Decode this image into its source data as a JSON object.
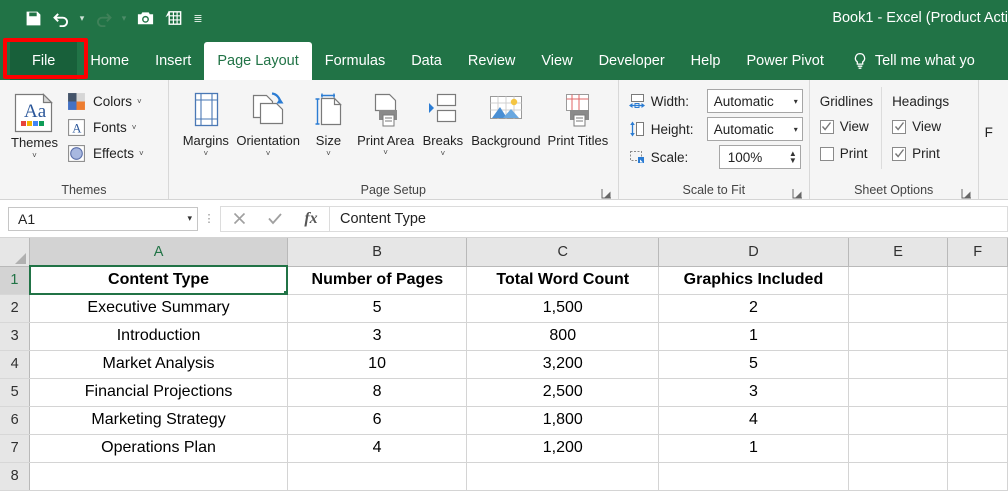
{
  "titlebar": {
    "app_title": "Book1  -  Excel (Product Acti",
    "quick_access": [
      {
        "name": "save-icon",
        "label": "Save"
      },
      {
        "name": "undo-icon",
        "label": "Undo"
      },
      {
        "name": "redo-icon",
        "label": "Redo"
      },
      {
        "name": "camera-icon",
        "label": "Camera"
      },
      {
        "name": "quick-table-icon",
        "label": "Quick Table"
      },
      {
        "name": "customize-quick-access-toolbar-icon",
        "label": "Customize Quick Access Toolbar"
      }
    ]
  },
  "tabs": {
    "file": "File",
    "items": [
      {
        "label": "Home",
        "active": false
      },
      {
        "label": "Insert",
        "active": false
      },
      {
        "label": "Page Layout",
        "active": true
      },
      {
        "label": "Formulas",
        "active": false
      },
      {
        "label": "Data",
        "active": false
      },
      {
        "label": "Review",
        "active": false
      },
      {
        "label": "View",
        "active": false
      },
      {
        "label": "Developer",
        "active": false
      },
      {
        "label": "Help",
        "active": false
      },
      {
        "label": "Power Pivot",
        "active": false
      }
    ],
    "tell_me": "Tell me what yo",
    "highlight_color": "#ff0000"
  },
  "ribbon": {
    "accent_color": "#217346",
    "themes": {
      "group_label": "Themes",
      "big_button": {
        "label": "Themes",
        "arrow": "˅"
      },
      "small_buttons": [
        {
          "label": "Colors",
          "arrow": "˅"
        },
        {
          "label": "Fonts",
          "arrow": "˅"
        },
        {
          "label": "Effects",
          "arrow": "˅"
        }
      ]
    },
    "page_setup": {
      "group_label": "Page Setup",
      "buttons": [
        {
          "label": "Margins",
          "arrow": "˅"
        },
        {
          "label": "Orientation",
          "arrow": "˅"
        },
        {
          "label": "Size",
          "arrow": "˅"
        },
        {
          "label": "Print Area",
          "arrow": "˅"
        },
        {
          "label": "Breaks",
          "arrow": "˅"
        },
        {
          "label": "Background",
          "arrow": ""
        },
        {
          "label": "Print Titles",
          "arrow": ""
        }
      ]
    },
    "scale_to_fit": {
      "group_label": "Scale to Fit",
      "width_label": "Width:",
      "width_value": "Automatic",
      "height_label": "Height:",
      "height_value": "Automatic",
      "scale_label": "Scale:",
      "scale_value": "100%"
    },
    "sheet_options": {
      "group_label": "Sheet Options",
      "gridlines_head": "Gridlines",
      "gridlines_view": "View",
      "gridlines_view_checked": true,
      "gridlines_print": "Print",
      "gridlines_print_checked": false,
      "headings_head": "Headings",
      "headings_view": "View",
      "headings_view_checked": true,
      "headings_print": "Print",
      "headings_print_checked": true
    },
    "arrange": {
      "group_label_partial": "F"
    }
  },
  "formula_bar": {
    "name_box_value": "A1",
    "cancel_icon": "✕",
    "enter_icon": "✓",
    "function_icon": "fx",
    "formula_value": "Content Type"
  },
  "grid": {
    "columns": [
      "A",
      "B",
      "C",
      "D",
      "E",
      "F"
    ],
    "selected_cell": "A1",
    "rows": [
      {
        "num": "1",
        "cells": [
          "Content Type",
          "Number of Pages",
          "Total Word Count",
          "Graphics Included",
          "",
          ""
        ],
        "header": true
      },
      {
        "num": "2",
        "cells": [
          "Executive Summary",
          "5",
          "1,500",
          "2",
          "",
          ""
        ],
        "header": false
      },
      {
        "num": "3",
        "cells": [
          "Introduction",
          "3",
          "800",
          "1",
          "",
          ""
        ],
        "header": false
      },
      {
        "num": "4",
        "cells": [
          "Market Analysis",
          "10",
          "3,200",
          "5",
          "",
          ""
        ],
        "header": false
      },
      {
        "num": "5",
        "cells": [
          "Financial Projections",
          "8",
          "2,500",
          "3",
          "",
          ""
        ],
        "header": false
      },
      {
        "num": "6",
        "cells": [
          "Marketing Strategy",
          "6",
          "1,800",
          "4",
          "",
          ""
        ],
        "header": false
      },
      {
        "num": "7",
        "cells": [
          "Operations Plan",
          "4",
          "1,200",
          "1",
          "",
          ""
        ],
        "header": false
      },
      {
        "num": "8",
        "cells": [
          "",
          "",
          "",
          "",
          "",
          ""
        ],
        "header": false
      }
    ]
  }
}
